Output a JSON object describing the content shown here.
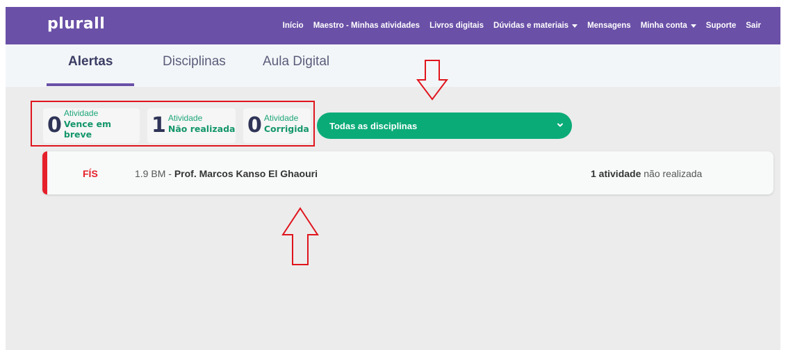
{
  "brand": {
    "logo": "plurall",
    "nav_color": "#6a50a7",
    "accent_green": "#0bab78",
    "alert_red": "#e6202a"
  },
  "nav": {
    "items": [
      {
        "label": "Início",
        "dropdown": false
      },
      {
        "label": "Maestro - Minhas atividades",
        "dropdown": false
      },
      {
        "label": "Livros digitais",
        "dropdown": false
      },
      {
        "label": "Dúvidas e materiais",
        "dropdown": true
      },
      {
        "label": "Mensagens",
        "dropdown": false
      },
      {
        "label": "Minha conta",
        "dropdown": true
      },
      {
        "label": "Suporte",
        "dropdown": false
      },
      {
        "label": "Sair",
        "dropdown": false
      }
    ]
  },
  "tabs": [
    {
      "label": "Alertas",
      "active": true
    },
    {
      "label": "Disciplinas",
      "active": false
    },
    {
      "label": "Aula Digital",
      "active": false
    }
  ],
  "stats": [
    {
      "count": "0",
      "label": "Atividade",
      "status": "Vence em breve"
    },
    {
      "count": "1",
      "label": "Atividade",
      "status": "Não realizada"
    },
    {
      "count": "0",
      "label": "Atividade",
      "status": "Corrigida"
    }
  ],
  "filter": {
    "selected": "Todas as disciplinas"
  },
  "alerts": [
    {
      "subject": "FÍS",
      "class_code": "1.9 BM",
      "separator": " - ",
      "teacher": "Prof. Marcos Kanso El Ghaouri",
      "count_text": "1 atividade",
      "status_text": " não realizada"
    }
  ],
  "annotation_color": "#e0141c"
}
